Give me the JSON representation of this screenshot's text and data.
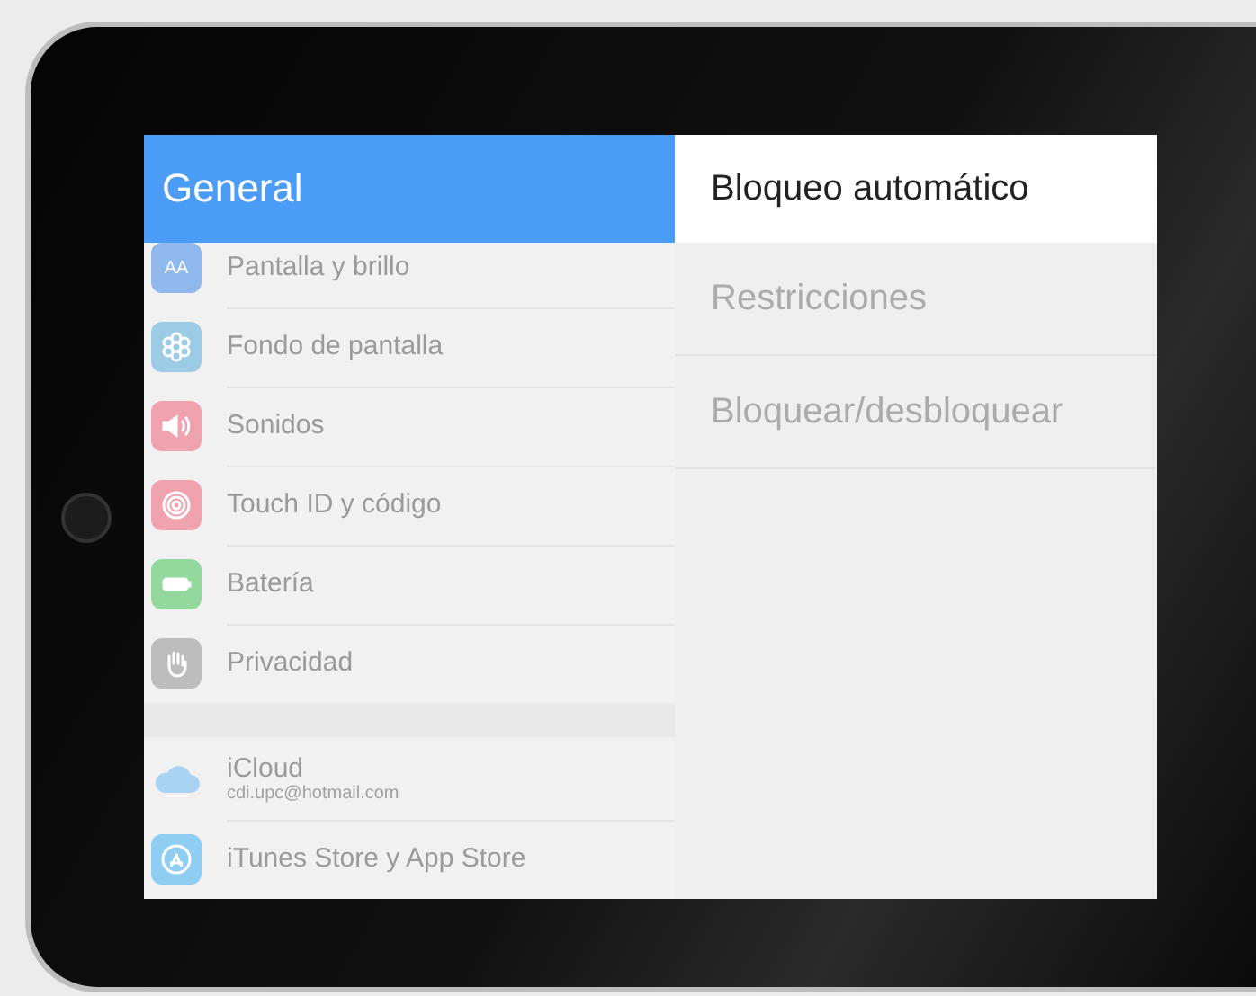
{
  "sidebar": {
    "title": "General",
    "groups": [
      {
        "items": [
          {
            "label": "Pantalla y brillo",
            "color": "#8fb8ec",
            "glyph": "AA"
          },
          {
            "label": "Fondo de pantalla",
            "color": "#9ccbe6"
          },
          {
            "label": "Sonidos",
            "color": "#f0a3ae"
          },
          {
            "label": "Touch ID y código",
            "color": "#f0a3ae"
          },
          {
            "label": "Batería",
            "color": "#93d99e"
          },
          {
            "label": "Privacidad",
            "color": "#bdbdbd"
          }
        ]
      },
      {
        "items": [
          {
            "label": "iCloud",
            "subtitle": "cdi.upc@hotmail.com",
            "color": "#a9d3f2"
          },
          {
            "label": "iTunes Store y App Store",
            "color": "#8fcdf2"
          }
        ]
      }
    ]
  },
  "detail": {
    "items": [
      {
        "label": "Bloqueo automático",
        "selected": true
      },
      {
        "label": "Restricciones",
        "selected": false
      },
      {
        "label": "Bloquear/desbloquear",
        "selected": false
      }
    ]
  }
}
